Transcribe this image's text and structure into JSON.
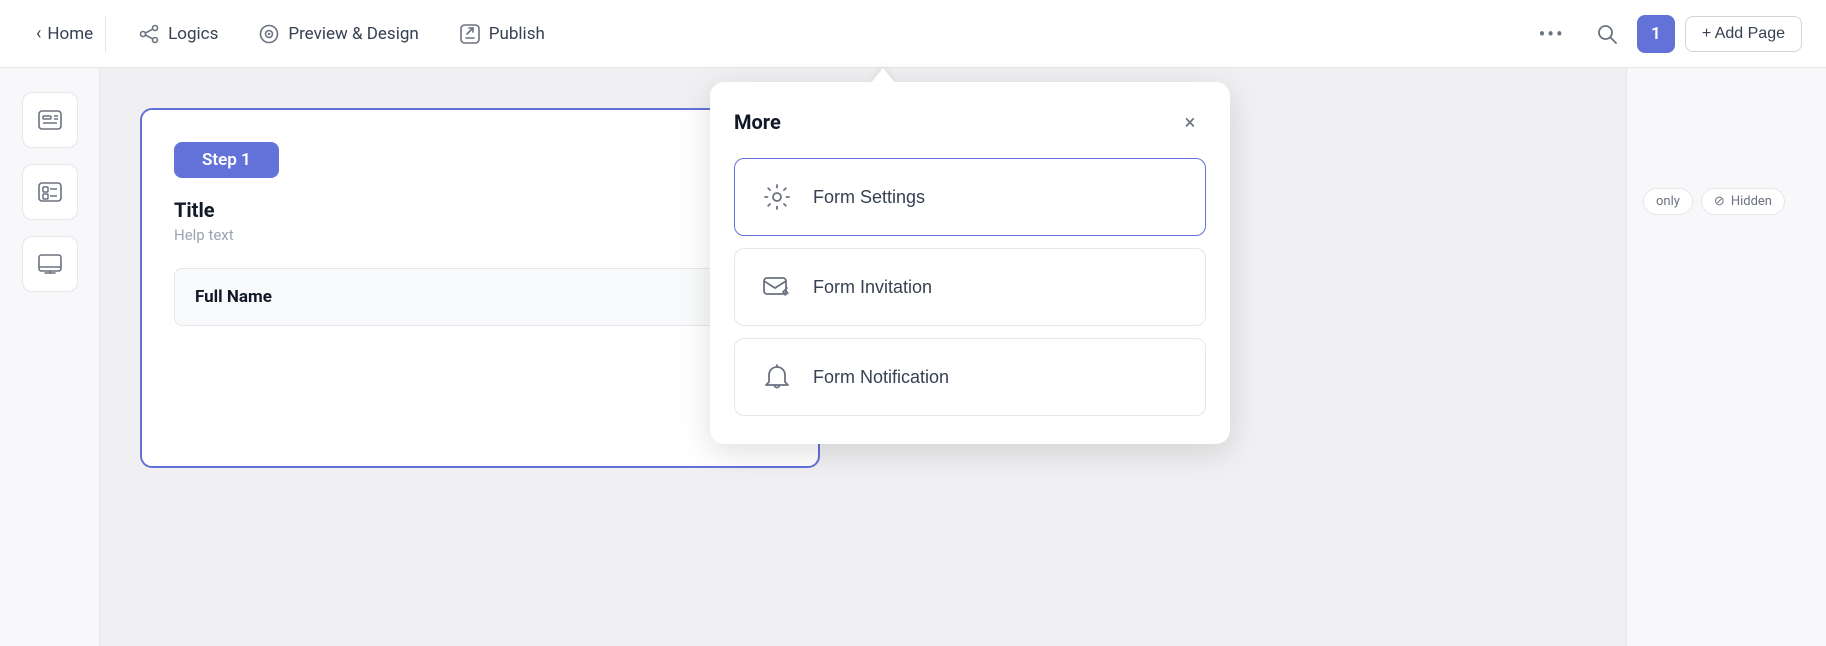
{
  "topnav": {
    "home_label": "Home",
    "logics_label": "Logics",
    "preview_label": "Preview & Design",
    "publish_label": "Publish",
    "more_dots": "•••",
    "page_number": "1",
    "add_page_label": "+ Add Page"
  },
  "sidebar_tools": {
    "tool1_icon": "form-icon",
    "tool2_icon": "checklist-icon",
    "tool3_icon": "screen-icon"
  },
  "form_canvas": {
    "step_label": "Step 1",
    "title": "Title",
    "help_text": "Help text",
    "field_label": "Full Name"
  },
  "right_panel": {
    "only_badge": "only",
    "hidden_badge": "Hidden"
  },
  "dropdown": {
    "title": "More",
    "close_icon": "×",
    "items": [
      {
        "icon": "settings-icon",
        "label": "Form Settings"
      },
      {
        "icon": "envelope-edit-icon",
        "label": "Form Invitation"
      },
      {
        "icon": "bell-icon",
        "label": "Form Notification"
      }
    ]
  },
  "colors": {
    "accent": "#6272d9",
    "border": "#e5e7eb",
    "text_primary": "#111827",
    "text_secondary": "#6b7280"
  }
}
